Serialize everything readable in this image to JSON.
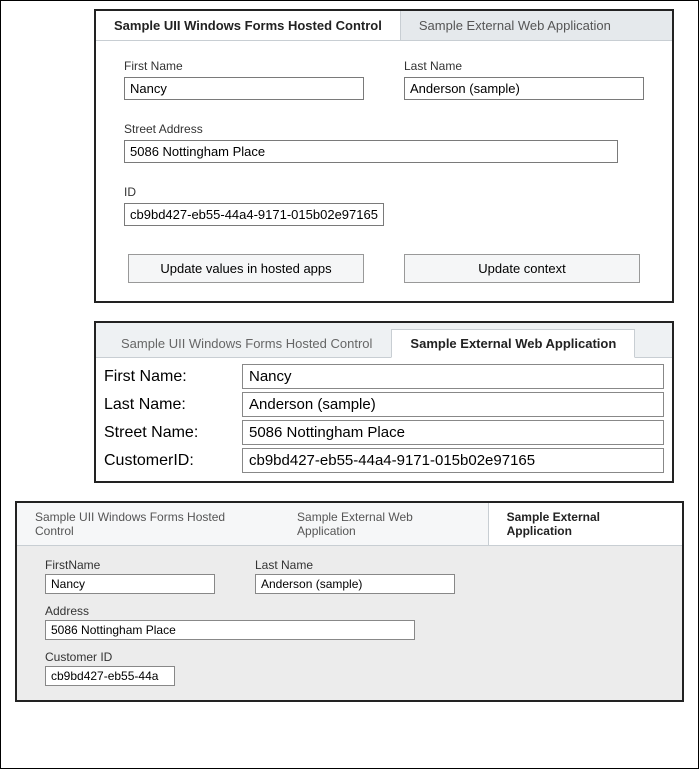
{
  "panel1": {
    "tabs": {
      "hosted": "Sample UII Windows Forms Hosted Control",
      "web": "Sample External Web Application"
    },
    "firstNameLabel": "First Name",
    "firstName": "Nancy",
    "lastNameLabel": "Last Name",
    "lastName": "Anderson (sample)",
    "streetLabel": "Street Address",
    "street": "5086 Nottingham Place",
    "idLabel": "ID",
    "id": "cb9bd427-eb55-44a4-9171-015b02e97165",
    "btnUpdateHosted": "Update values in hosted apps",
    "btnUpdateContext": "Update context"
  },
  "panel2": {
    "tabs": {
      "hosted": "Sample UII Windows Forms Hosted Control",
      "web": "Sample External Web Application"
    },
    "firstNameLabel": "First Name:",
    "firstName": "Nancy",
    "lastNameLabel": "Last Name:",
    "lastName": "Anderson (sample)",
    "streetLabel": "Street Name:",
    "street": "5086 Nottingham Place",
    "custIdLabel": "CustomerID:",
    "custId": "cb9bd427-eb55-44a4-9171-015b02e97165"
  },
  "panel3": {
    "tabs": {
      "hosted": "Sample UII Windows Forms Hosted Control",
      "web": "Sample External Web Application",
      "ext": "Sample External Application"
    },
    "firstNameLabel": "FirstName",
    "firstName": "Nancy",
    "lastNameLabel": "Last Name",
    "lastName": "Anderson (sample)",
    "addrLabel": "Address",
    "addr": "5086 Nottingham Place",
    "custLabel": "Customer ID",
    "cust": "cb9bd427-eb55-44a"
  }
}
